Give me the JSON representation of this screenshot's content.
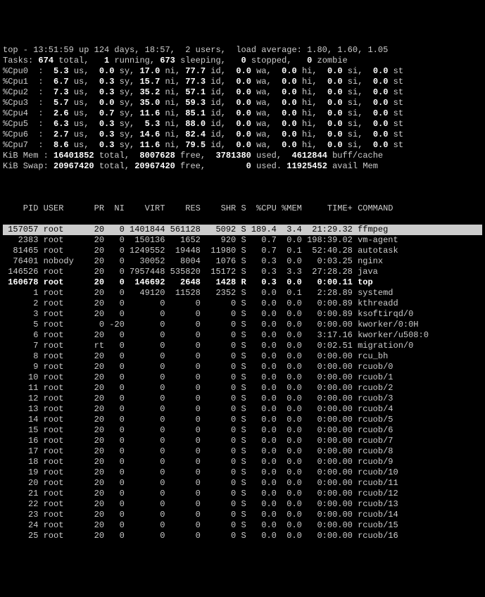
{
  "header": {
    "line1": {
      "time": "13:51:59",
      "up": "124 days, 18:57",
      "users": "2",
      "la": "1.80, 1.60, 1.05"
    },
    "tasks": {
      "total": "674",
      "running": "1",
      "sleeping": "673",
      "stopped": "0",
      "zombie": "0"
    },
    "cpus": [
      {
        "n": "0",
        "us": "5.3",
        "sy": "0.0",
        "ni": "17.0",
        "id": "77.7",
        "wa": "0.0",
        "hi": "0.0",
        "si": "0.0",
        "st": "0.0"
      },
      {
        "n": "1",
        "us": "6.7",
        "sy": "0.3",
        "ni": "15.7",
        "id": "77.3",
        "wa": "0.0",
        "hi": "0.0",
        "si": "0.0",
        "st": "0.0"
      },
      {
        "n": "2",
        "us": "7.3",
        "sy": "0.3",
        "ni": "35.2",
        "id": "57.1",
        "wa": "0.0",
        "hi": "0.0",
        "si": "0.0",
        "st": "0.0"
      },
      {
        "n": "3",
        "us": "5.7",
        "sy": "0.0",
        "ni": "35.0",
        "id": "59.3",
        "wa": "0.0",
        "hi": "0.0",
        "si": "0.0",
        "st": "0.0"
      },
      {
        "n": "4",
        "us": "2.6",
        "sy": "0.7",
        "ni": "11.6",
        "id": "85.1",
        "wa": "0.0",
        "hi": "0.0",
        "si": "0.0",
        "st": "0.0"
      },
      {
        "n": "5",
        "us": "6.3",
        "sy": "0.3",
        "ni": "5.3",
        "id": "88.0",
        "wa": "0.0",
        "hi": "0.0",
        "si": "0.0",
        "st": "0.0"
      },
      {
        "n": "6",
        "us": "2.7",
        "sy": "0.3",
        "ni": "14.6",
        "id": "82.4",
        "wa": "0.0",
        "hi": "0.0",
        "si": "0.0",
        "st": "0.0"
      },
      {
        "n": "7",
        "us": "8.6",
        "sy": "0.3",
        "ni": "11.6",
        "id": "79.5",
        "wa": "0.0",
        "hi": "0.0",
        "si": "0.0",
        "st": "0.0"
      }
    ],
    "mem": {
      "total": "16401852",
      "free": "8007628",
      "used": "3781380",
      "buff": "4612844"
    },
    "swap": {
      "total": "20967420",
      "free": "20967420",
      "used": "0",
      "avail": "11925452"
    }
  },
  "columns": "    PID USER      PR  NI    VIRT    RES    SHR S  %CPU %MEM     TIME+ COMMAND",
  "processes": [
    {
      "pid": "157057",
      "user": "root",
      "pr": "20",
      "ni": "0",
      "virt": "1401844",
      "res": "561128",
      "shr": "5092",
      "s": "S",
      "cpu": "189.4",
      "mem": "3.4",
      "time": "21:29.32",
      "cmd": "ffmpeg",
      "hl": true
    },
    {
      "pid": "2383",
      "user": "root",
      "pr": "20",
      "ni": "0",
      "virt": "150136",
      "res": "1652",
      "shr": "920",
      "s": "S",
      "cpu": "0.7",
      "mem": "0.0",
      "time": "198:39.02",
      "cmd": "vm-agent"
    },
    {
      "pid": "81465",
      "user": "root",
      "pr": "20",
      "ni": "0",
      "virt": "1249552",
      "res": "19448",
      "shr": "11980",
      "s": "S",
      "cpu": "0.7",
      "mem": "0.1",
      "time": "52:40.28",
      "cmd": "autotask"
    },
    {
      "pid": "76401",
      "user": "nobody",
      "pr": "20",
      "ni": "0",
      "virt": "30052",
      "res": "8004",
      "shr": "1076",
      "s": "S",
      "cpu": "0.3",
      "mem": "0.0",
      "time": "0:03.25",
      "cmd": "nginx"
    },
    {
      "pid": "146526",
      "user": "root",
      "pr": "20",
      "ni": "0",
      "virt": "7957448",
      "res": "535820",
      "shr": "15172",
      "s": "S",
      "cpu": "0.3",
      "mem": "3.3",
      "time": "27:28.28",
      "cmd": "java"
    },
    {
      "pid": "160678",
      "user": "root",
      "pr": "20",
      "ni": "0",
      "virt": "146692",
      "res": "2648",
      "shr": "1428",
      "s": "R",
      "cpu": "0.3",
      "mem": "0.0",
      "time": "0:00.11",
      "cmd": "top",
      "bold": true
    },
    {
      "pid": "1",
      "user": "root",
      "pr": "20",
      "ni": "0",
      "virt": "49120",
      "res": "11528",
      "shr": "2352",
      "s": "S",
      "cpu": "0.0",
      "mem": "0.1",
      "time": "2:28.89",
      "cmd": "systemd"
    },
    {
      "pid": "2",
      "user": "root",
      "pr": "20",
      "ni": "0",
      "virt": "0",
      "res": "0",
      "shr": "0",
      "s": "S",
      "cpu": "0.0",
      "mem": "0.0",
      "time": "0:00.89",
      "cmd": "kthreadd"
    },
    {
      "pid": "3",
      "user": "root",
      "pr": "20",
      "ni": "0",
      "virt": "0",
      "res": "0",
      "shr": "0",
      "s": "S",
      "cpu": "0.0",
      "mem": "0.0",
      "time": "0:00.89",
      "cmd": "ksoftirqd/0"
    },
    {
      "pid": "5",
      "user": "root",
      "pr": "0",
      "ni": "-20",
      "virt": "0",
      "res": "0",
      "shr": "0",
      "s": "S",
      "cpu": "0.0",
      "mem": "0.0",
      "time": "0:00.00",
      "cmd": "kworker/0:0H"
    },
    {
      "pid": "6",
      "user": "root",
      "pr": "20",
      "ni": "0",
      "virt": "0",
      "res": "0",
      "shr": "0",
      "s": "S",
      "cpu": "0.0",
      "mem": "0.0",
      "time": "3:17.16",
      "cmd": "kworker/u508:0"
    },
    {
      "pid": "7",
      "user": "root",
      "pr": "rt",
      "ni": "0",
      "virt": "0",
      "res": "0",
      "shr": "0",
      "s": "S",
      "cpu": "0.0",
      "mem": "0.0",
      "time": "0:02.51",
      "cmd": "migration/0"
    },
    {
      "pid": "8",
      "user": "root",
      "pr": "20",
      "ni": "0",
      "virt": "0",
      "res": "0",
      "shr": "0",
      "s": "S",
      "cpu": "0.0",
      "mem": "0.0",
      "time": "0:00.00",
      "cmd": "rcu_bh"
    },
    {
      "pid": "9",
      "user": "root",
      "pr": "20",
      "ni": "0",
      "virt": "0",
      "res": "0",
      "shr": "0",
      "s": "S",
      "cpu": "0.0",
      "mem": "0.0",
      "time": "0:00.00",
      "cmd": "rcuob/0"
    },
    {
      "pid": "10",
      "user": "root",
      "pr": "20",
      "ni": "0",
      "virt": "0",
      "res": "0",
      "shr": "0",
      "s": "S",
      "cpu": "0.0",
      "mem": "0.0",
      "time": "0:00.00",
      "cmd": "rcuob/1"
    },
    {
      "pid": "11",
      "user": "root",
      "pr": "20",
      "ni": "0",
      "virt": "0",
      "res": "0",
      "shr": "0",
      "s": "S",
      "cpu": "0.0",
      "mem": "0.0",
      "time": "0:00.00",
      "cmd": "rcuob/2"
    },
    {
      "pid": "12",
      "user": "root",
      "pr": "20",
      "ni": "0",
      "virt": "0",
      "res": "0",
      "shr": "0",
      "s": "S",
      "cpu": "0.0",
      "mem": "0.0",
      "time": "0:00.00",
      "cmd": "rcuob/3"
    },
    {
      "pid": "13",
      "user": "root",
      "pr": "20",
      "ni": "0",
      "virt": "0",
      "res": "0",
      "shr": "0",
      "s": "S",
      "cpu": "0.0",
      "mem": "0.0",
      "time": "0:00.00",
      "cmd": "rcuob/4"
    },
    {
      "pid": "14",
      "user": "root",
      "pr": "20",
      "ni": "0",
      "virt": "0",
      "res": "0",
      "shr": "0",
      "s": "S",
      "cpu": "0.0",
      "mem": "0.0",
      "time": "0:00.00",
      "cmd": "rcuob/5"
    },
    {
      "pid": "15",
      "user": "root",
      "pr": "20",
      "ni": "0",
      "virt": "0",
      "res": "0",
      "shr": "0",
      "s": "S",
      "cpu": "0.0",
      "mem": "0.0",
      "time": "0:00.00",
      "cmd": "rcuob/6"
    },
    {
      "pid": "16",
      "user": "root",
      "pr": "20",
      "ni": "0",
      "virt": "0",
      "res": "0",
      "shr": "0",
      "s": "S",
      "cpu": "0.0",
      "mem": "0.0",
      "time": "0:00.00",
      "cmd": "rcuob/7"
    },
    {
      "pid": "17",
      "user": "root",
      "pr": "20",
      "ni": "0",
      "virt": "0",
      "res": "0",
      "shr": "0",
      "s": "S",
      "cpu": "0.0",
      "mem": "0.0",
      "time": "0:00.00",
      "cmd": "rcuob/8"
    },
    {
      "pid": "18",
      "user": "root",
      "pr": "20",
      "ni": "0",
      "virt": "0",
      "res": "0",
      "shr": "0",
      "s": "S",
      "cpu": "0.0",
      "mem": "0.0",
      "time": "0:00.00",
      "cmd": "rcuob/9"
    },
    {
      "pid": "19",
      "user": "root",
      "pr": "20",
      "ni": "0",
      "virt": "0",
      "res": "0",
      "shr": "0",
      "s": "S",
      "cpu": "0.0",
      "mem": "0.0",
      "time": "0:00.00",
      "cmd": "rcuob/10"
    },
    {
      "pid": "20",
      "user": "root",
      "pr": "20",
      "ni": "0",
      "virt": "0",
      "res": "0",
      "shr": "0",
      "s": "S",
      "cpu": "0.0",
      "mem": "0.0",
      "time": "0:00.00",
      "cmd": "rcuob/11"
    },
    {
      "pid": "21",
      "user": "root",
      "pr": "20",
      "ni": "0",
      "virt": "0",
      "res": "0",
      "shr": "0",
      "s": "S",
      "cpu": "0.0",
      "mem": "0.0",
      "time": "0:00.00",
      "cmd": "rcuob/12"
    },
    {
      "pid": "22",
      "user": "root",
      "pr": "20",
      "ni": "0",
      "virt": "0",
      "res": "0",
      "shr": "0",
      "s": "S",
      "cpu": "0.0",
      "mem": "0.0",
      "time": "0:00.00",
      "cmd": "rcuob/13"
    },
    {
      "pid": "23",
      "user": "root",
      "pr": "20",
      "ni": "0",
      "virt": "0",
      "res": "0",
      "shr": "0",
      "s": "S",
      "cpu": "0.0",
      "mem": "0.0",
      "time": "0:00.00",
      "cmd": "rcuob/14"
    },
    {
      "pid": "24",
      "user": "root",
      "pr": "20",
      "ni": "0",
      "virt": "0",
      "res": "0",
      "shr": "0",
      "s": "S",
      "cpu": "0.0",
      "mem": "0.0",
      "time": "0:00.00",
      "cmd": "rcuob/15"
    },
    {
      "pid": "25",
      "user": "root",
      "pr": "20",
      "ni": "0",
      "virt": "0",
      "res": "0",
      "shr": "0",
      "s": "S",
      "cpu": "0.0",
      "mem": "0.0",
      "time": "0:00.00",
      "cmd": "rcuob/16"
    }
  ]
}
